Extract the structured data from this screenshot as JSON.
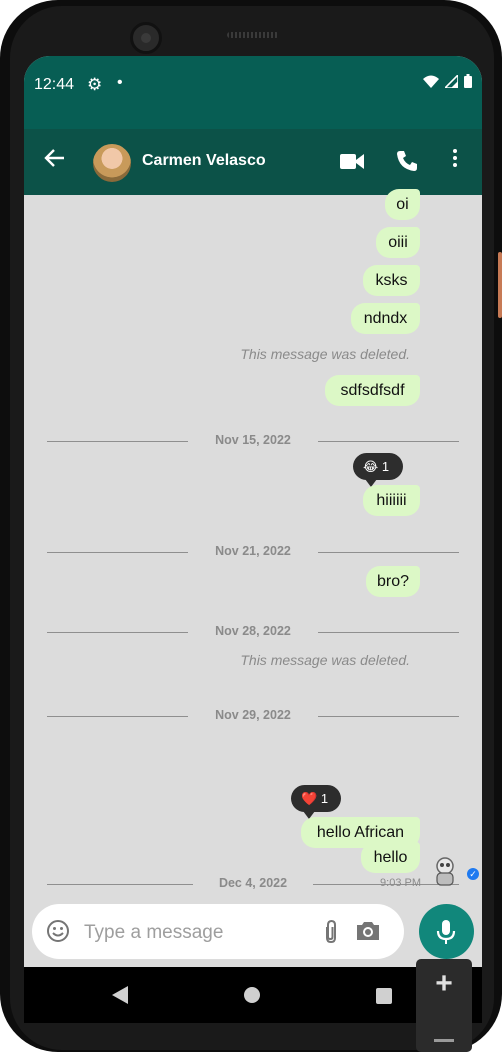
{
  "status": {
    "time": "12:44",
    "dot": "•"
  },
  "header": {
    "contact_name": "Carmen Velasco"
  },
  "messages": {
    "m1": "oi",
    "m2": "oiii",
    "m3": "ksks",
    "m4": "ndndx",
    "deleted1": "This message was deleted.",
    "m5": "sdfsdfsdf",
    "date1": "Nov 15, 2022",
    "reaction1_emoji": "😂",
    "reaction1_count": "1",
    "m6": "hiiiiii",
    "date2": "Nov 21, 2022",
    "m7": "bro?",
    "date3": "Nov 28, 2022",
    "deleted2": "This message was deleted.",
    "date4": "Nov 29, 2022",
    "reaction2_emoji": "❤️",
    "reaction2_count": "1",
    "m8": "hello African",
    "date5": "Dec 4, 2022",
    "m9": "hello",
    "m9_time": "9:03 PM"
  },
  "input": {
    "placeholder": "Type a message"
  },
  "icons": {
    "back": "arrow-left-icon",
    "video": "video-camera-icon",
    "call": "phone-icon",
    "menu": "more-vertical-icon",
    "emoji": "emoji-icon",
    "attach": "paperclip-icon",
    "camera": "camera-icon",
    "mic": "microphone-icon"
  },
  "colors": {
    "header": "#075e54",
    "app_bar": "#0c5248",
    "bubble_out": "#dcf8c6",
    "chat_background": "#dcdcdc",
    "mic_button": "#11877b",
    "read_tick": "#1f7af0"
  }
}
